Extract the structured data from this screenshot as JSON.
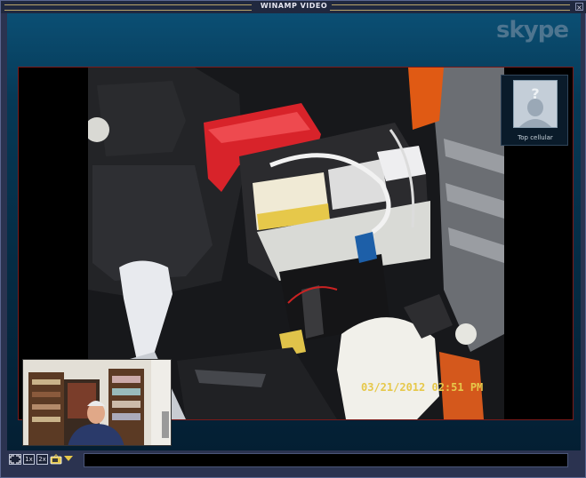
{
  "window": {
    "title": "WINAMP VIDEO",
    "close_glyph": "×"
  },
  "brand": {
    "logo_text": "skype"
  },
  "remote_video": {
    "timestamp": "03/21/2012 02:51 PM"
  },
  "contact": {
    "name": "Top cellular"
  },
  "controls": {
    "fullscreen_icon": "fullscreen-icon",
    "size_1x_label": "1x",
    "size_2x_label": "2x",
    "tv_icon": "tv-icon",
    "menu_icon": "dropdown-arrow-icon"
  }
}
